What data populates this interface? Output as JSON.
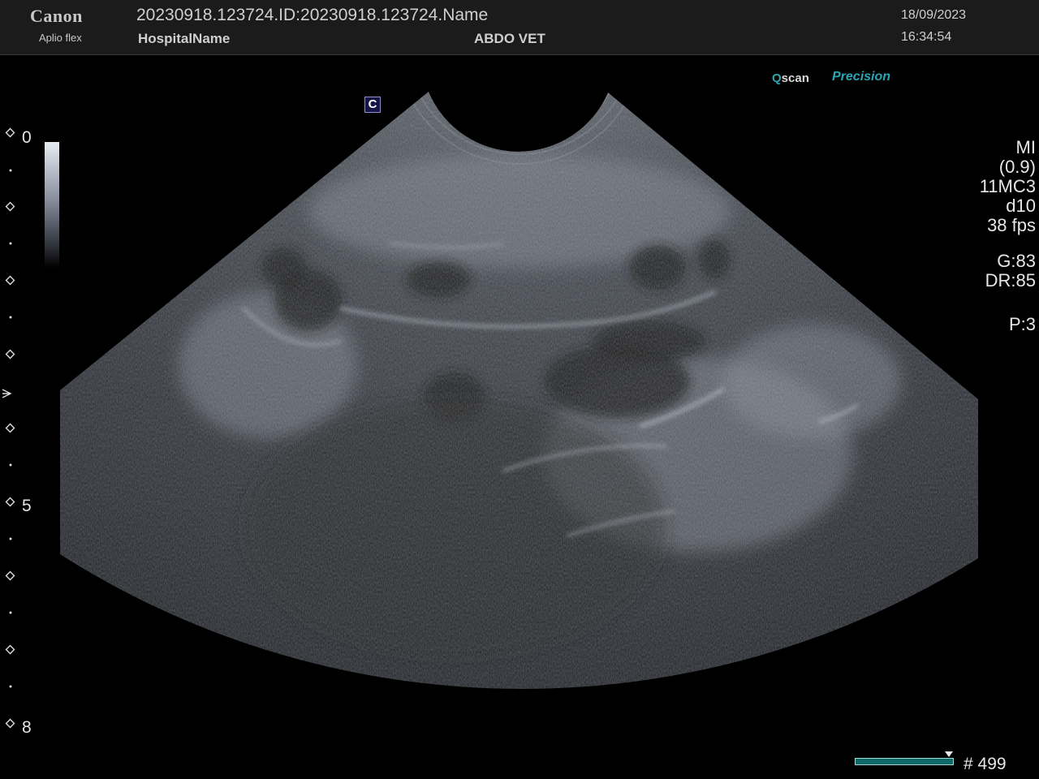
{
  "header": {
    "brand": "Canon",
    "model": "Aplio flex",
    "patient_id": "20230918.123724.ID:20230918.123724.Name",
    "hospital": "HospitalName",
    "exam": "ABDO VET",
    "date": "18/09/2023",
    "time": "16:34:54"
  },
  "image_overlay": {
    "qscan_prefix": "Q",
    "qscan_suffix": "scan",
    "precision": "Precision",
    "orientation_mark": "C"
  },
  "depth_scale": {
    "labels": [
      "0",
      "5",
      "8"
    ],
    "unit_hint": ""
  },
  "params": {
    "mi_label": "MI",
    "mi_value": "(0.9)",
    "probe": "11MC3",
    "depth": "d10",
    "frame_rate": "38 fps",
    "gain": "G:83",
    "dynamic_range": "DR:85",
    "preset": "P:3"
  },
  "cine": {
    "frame_counter": "# 499",
    "position": 0.91
  },
  "colors": {
    "accent": "#2aa6b3",
    "cine_fill": "#0e6a68"
  }
}
